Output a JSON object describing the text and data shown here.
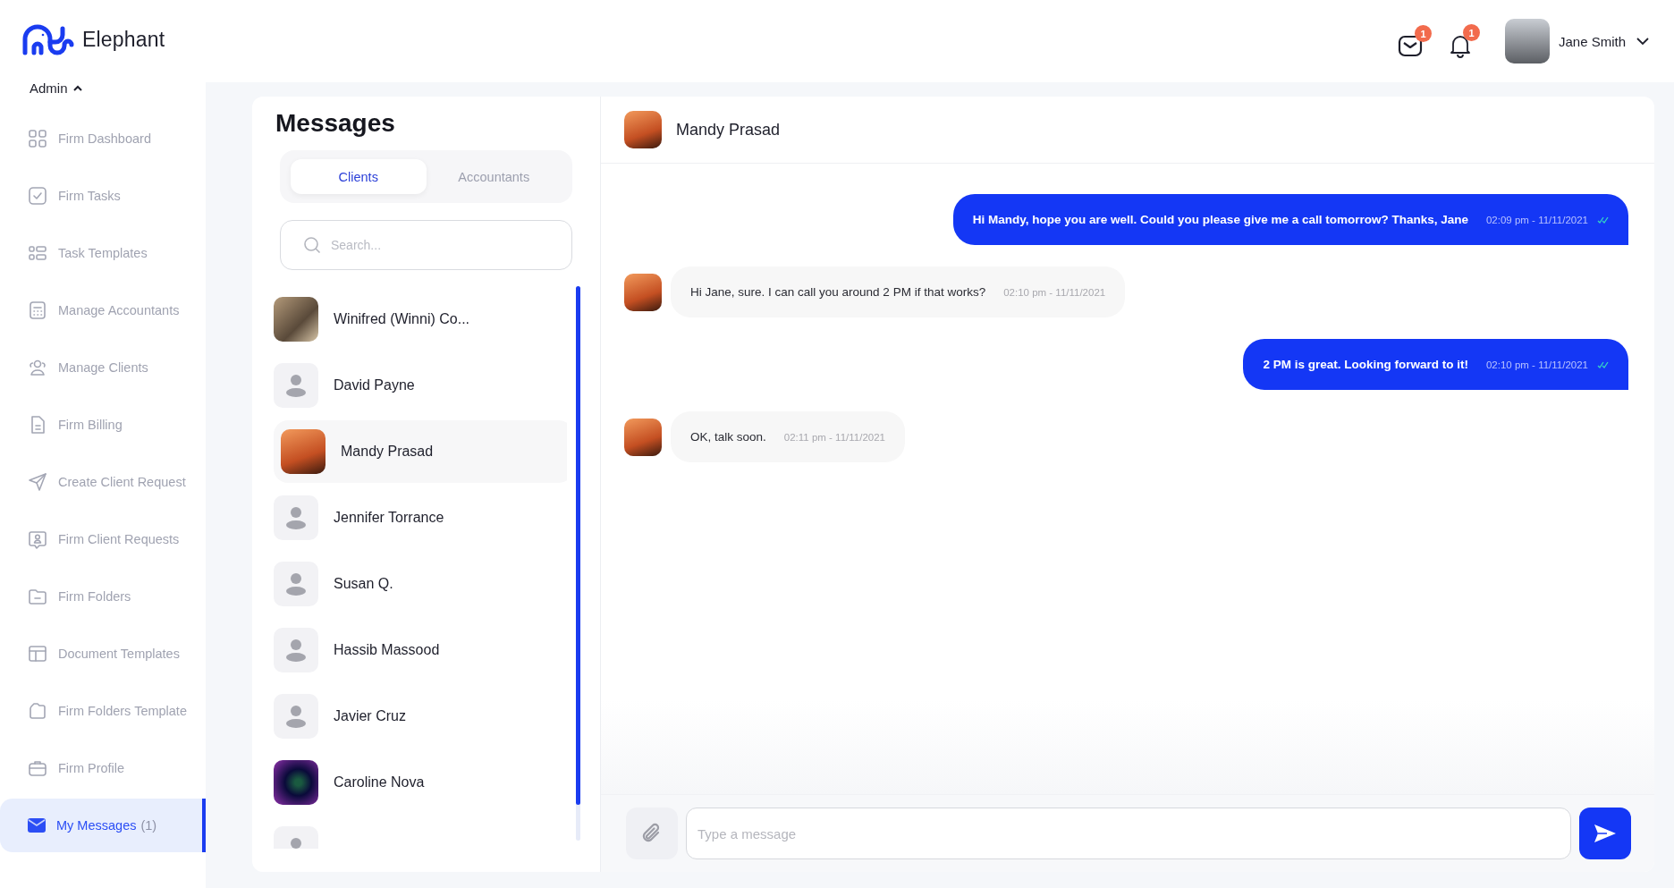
{
  "brand": {
    "name": "Elephant"
  },
  "sidebar": {
    "section": {
      "label": "Admin",
      "expanded": true
    },
    "items": [
      {
        "label": "Firm Dashboard",
        "selected": false
      },
      {
        "label": "Firm Tasks",
        "selected": false
      },
      {
        "label": "Task Templates",
        "selected": false
      },
      {
        "label": "Manage Accountants",
        "selected": false
      },
      {
        "label": "Manage Clients",
        "selected": false
      },
      {
        "label": "Firm Billing",
        "selected": false
      },
      {
        "label": "Create Client Request",
        "selected": false
      },
      {
        "label": "Firm Client Requests",
        "selected": false
      },
      {
        "label": "Firm Folders",
        "selected": false
      },
      {
        "label": "Document Templates",
        "selected": false
      },
      {
        "label": "Firm Folders Template",
        "selected": false
      },
      {
        "label": "Firm Profile",
        "selected": false
      },
      {
        "label": "My Messages",
        "count": "(1)",
        "selected": true
      }
    ]
  },
  "header": {
    "mail_badge": "1",
    "notification_badge": "1",
    "user_name": "Jane Smith"
  },
  "messages_panel": {
    "title": "Messages",
    "tabs": [
      {
        "label": "Clients",
        "selected": true
      },
      {
        "label": "Accountants",
        "selected": false
      }
    ],
    "search": {
      "placeholder": "Search..."
    },
    "contacts": [
      {
        "name": "Winifred (Winni) Co...",
        "kind": "photo",
        "selected": false
      },
      {
        "name": "David Payne",
        "kind": "placeholder",
        "selected": false
      },
      {
        "name": "Mandy Prasad",
        "kind": "photo",
        "selected": true
      },
      {
        "name": "Jennifer Torrance",
        "kind": "placeholder",
        "selected": false
      },
      {
        "name": "Susan Q.",
        "kind": "placeholder",
        "selected": false
      },
      {
        "name": "Hassib Massood",
        "kind": "placeholder",
        "selected": false
      },
      {
        "name": "Javier Cruz",
        "kind": "placeholder",
        "selected": false
      },
      {
        "name": "Caroline Nova",
        "kind": "photo",
        "selected": false
      },
      {
        "kind": "placeholder",
        "selected": false
      }
    ]
  },
  "chat": {
    "contact_name": "Mandy Prasad",
    "messages": [
      {
        "kind": "outgoing",
        "text": "Hi Mandy, hope you are well. Could you please give me a call tomorrow? Thanks, Jane",
        "time": "02:09 pm - 11/11/2021",
        "read": true
      },
      {
        "kind": "incoming",
        "text": "Hi Jane, sure. I can call you around 2 PM if that works?",
        "time": "02:10 pm - 11/11/2021"
      },
      {
        "kind": "outgoing",
        "text": "2 PM is great. Looking forward to it!",
        "time": "02:10 pm - 11/11/2021",
        "read": true
      },
      {
        "kind": "incoming",
        "text": "OK, talk soon.",
        "time": "02:11 pm - 11/11/2021"
      }
    ],
    "composer": {
      "placeholder": "Type a message"
    }
  }
}
